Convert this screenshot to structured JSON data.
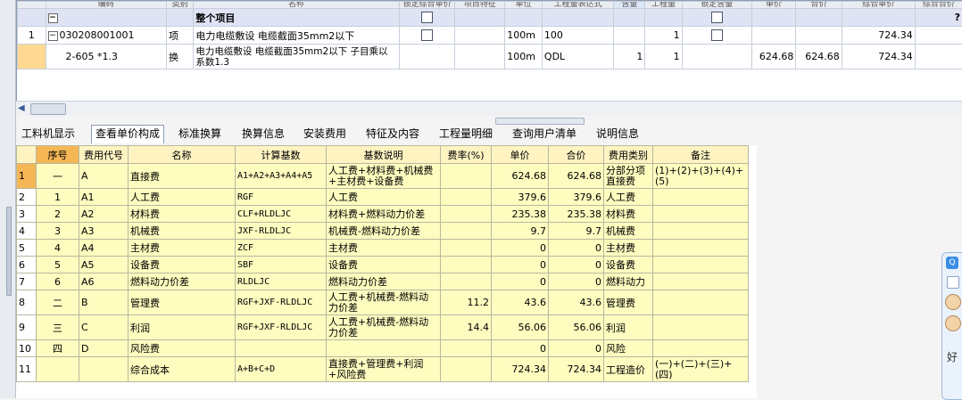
{
  "top_grid": {
    "headers": [
      "",
      "编码",
      "类别",
      "名称",
      "锁定综合单价",
      "项目特征",
      "单位",
      "工程量表达式",
      "含量",
      "工程量",
      "锁定含量",
      "单价",
      "合价",
      "综合单价",
      "综合合价"
    ],
    "group_row": {
      "toggle": "−",
      "name": "整个项目"
    },
    "rows": [
      {
        "row_no": "1",
        "toggle": "−",
        "code": "030208001001",
        "type": "项",
        "name": "电力电缆敷设 电缆截面35mm2以下",
        "unit": "100m",
        "expr": "100",
        "content": "",
        "qty": "1",
        "price": "",
        "total": "",
        "unit_price": "724.34",
        "total_price": ""
      },
      {
        "row_no": "",
        "code": "2-605 *1.3",
        "type": "换",
        "name": "电力电缆敷设 电缆截面35mm2以下 子目乘以系数1.3",
        "unit": "100m",
        "expr": "QDL",
        "content": "1",
        "qty": "1",
        "price": "624.68",
        "total": "624.68",
        "unit_price": "724.34",
        "total_price": ""
      }
    ],
    "cutoff_marker": "?"
  },
  "tabs": [
    "工料机显示",
    "查看单价构成",
    "标准换算",
    "换算信息",
    "安装费用",
    "特征及内容",
    "工程量明细",
    "查询用户清单",
    "说明信息"
  ],
  "active_tab": "查看单价构成",
  "cost_table": {
    "headers": [
      "",
      "序号",
      "费用代号",
      "名称",
      "计算基数",
      "基数说明",
      "费率(%)",
      "单价",
      "合价",
      "费用类别",
      "备注"
    ],
    "rows": [
      {
        "rn": "1",
        "seq": "一",
        "code": "A",
        "name": "直接费",
        "base": "A1+A2+A3+A4+A5",
        "desc": "人工费+材料费+机械费+主材费+设备费",
        "rate": "",
        "price": "624.68",
        "total": "624.68",
        "category": "分部分项直接费",
        "note": "(1)+(2)+(3)+(4)+(5)"
      },
      {
        "rn": "2",
        "seq": "1",
        "code": "A1",
        "name": "人工费",
        "base": "RGF",
        "desc": "人工费",
        "rate": "",
        "price": "379.6",
        "total": "379.6",
        "category": "人工费",
        "note": ""
      },
      {
        "rn": "3",
        "seq": "2",
        "code": "A2",
        "name": "材料费",
        "base": "CLF+RLDLJC",
        "desc": "材料费+燃料动力价差",
        "rate": "",
        "price": "235.38",
        "total": "235.38",
        "category": "材料费",
        "note": ""
      },
      {
        "rn": "4",
        "seq": "3",
        "code": "A3",
        "name": "机械费",
        "base": "JXF-RLDLJC",
        "desc": "机械费-燃料动力价差",
        "rate": "",
        "price": "9.7",
        "total": "9.7",
        "category": "机械费",
        "note": ""
      },
      {
        "rn": "5",
        "seq": "4",
        "code": "A4",
        "name": "主材费",
        "base": "ZCF",
        "desc": "主材费",
        "rate": "",
        "price": "0",
        "total": "0",
        "category": "主材费",
        "note": ""
      },
      {
        "rn": "6",
        "seq": "5",
        "code": "A5",
        "name": "设备费",
        "base": "SBF",
        "desc": "设备费",
        "rate": "",
        "price": "0",
        "total": "0",
        "category": "设备费",
        "note": ""
      },
      {
        "rn": "7",
        "seq": "6",
        "code": "A6",
        "name": "燃料动力价差",
        "base": "RLDLJC",
        "desc": "燃料动力价差",
        "rate": "",
        "price": "0",
        "total": "0",
        "category": "燃料动力",
        "note": ""
      },
      {
        "rn": "8",
        "seq": "二",
        "code": "B",
        "name": "管理费",
        "base": "RGF+JXF-RLDLJC",
        "desc": "人工费+机械费-燃料动力价差",
        "rate": "11.2",
        "price": "43.6",
        "total": "43.6",
        "category": "管理费",
        "note": ""
      },
      {
        "rn": "9",
        "seq": "三",
        "code": "C",
        "name": "利润",
        "base": "RGF+JXF-RLDLJC",
        "desc": "人工费+机械费-燃料动力价差",
        "rate": "14.4",
        "price": "56.06",
        "total": "56.06",
        "category": "利润",
        "note": ""
      },
      {
        "rn": "10",
        "seq": "四",
        "code": "D",
        "name": "风险费",
        "base": "",
        "desc": "",
        "rate": "",
        "price": "0",
        "total": "0",
        "category": "风险",
        "note": ""
      },
      {
        "rn": "11",
        "seq": "",
        "code": "",
        "name": "综合成本",
        "base": "A+B+C+D",
        "desc": "直接费+管理费+利润+风险费",
        "rate": "",
        "price": "724.34",
        "total": "724.34",
        "category": "工程造价",
        "note": "(一)+(二)+(三)+(四)"
      }
    ]
  },
  "side_widget": {
    "text": "好"
  },
  "icons": {
    "scroll_left": "arrow-left-icon",
    "tree_toggle": "tree-toggle-icon",
    "checkbox": "checkbox-icon",
    "side_app": "chat-app-icon"
  },
  "colors": {
    "cost_row_bg": "#fefcbf",
    "header_bg": "#fff3c2",
    "highlight": "#f5b655",
    "group_row_bg": "#dfe3f3"
  }
}
